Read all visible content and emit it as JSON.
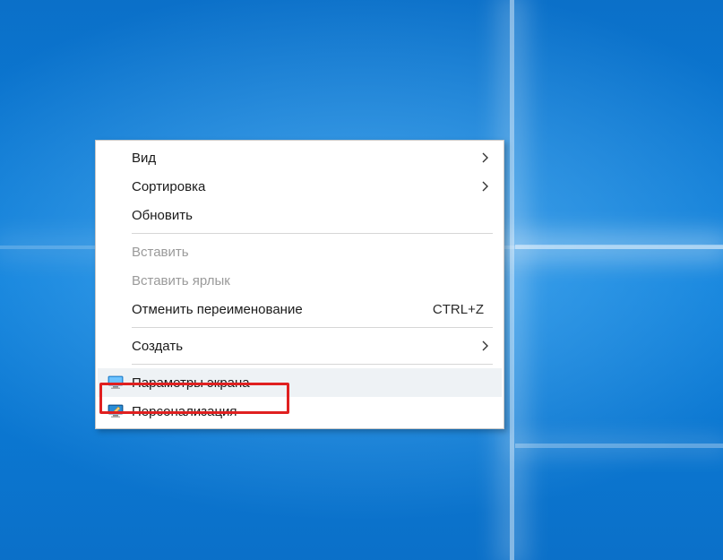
{
  "contextMenu": {
    "items": {
      "view": {
        "label": "Вид",
        "hasSubmenu": true
      },
      "sort": {
        "label": "Сортировка",
        "hasSubmenu": true
      },
      "refresh": {
        "label": "Обновить"
      },
      "paste": {
        "label": "Вставить",
        "disabled": true
      },
      "pasteShortcut": {
        "label": "Вставить ярлык",
        "disabled": true
      },
      "undoRename": {
        "label": "Отменить переименование",
        "shortcut": "CTRL+Z"
      },
      "new": {
        "label": "Создать",
        "hasSubmenu": true
      },
      "displaySettings": {
        "label": "Параметры экрана",
        "icon": "monitor"
      },
      "personalize": {
        "label": "Персонализация",
        "icon": "personalize"
      }
    }
  },
  "highlight": {
    "target": "displaySettings"
  }
}
